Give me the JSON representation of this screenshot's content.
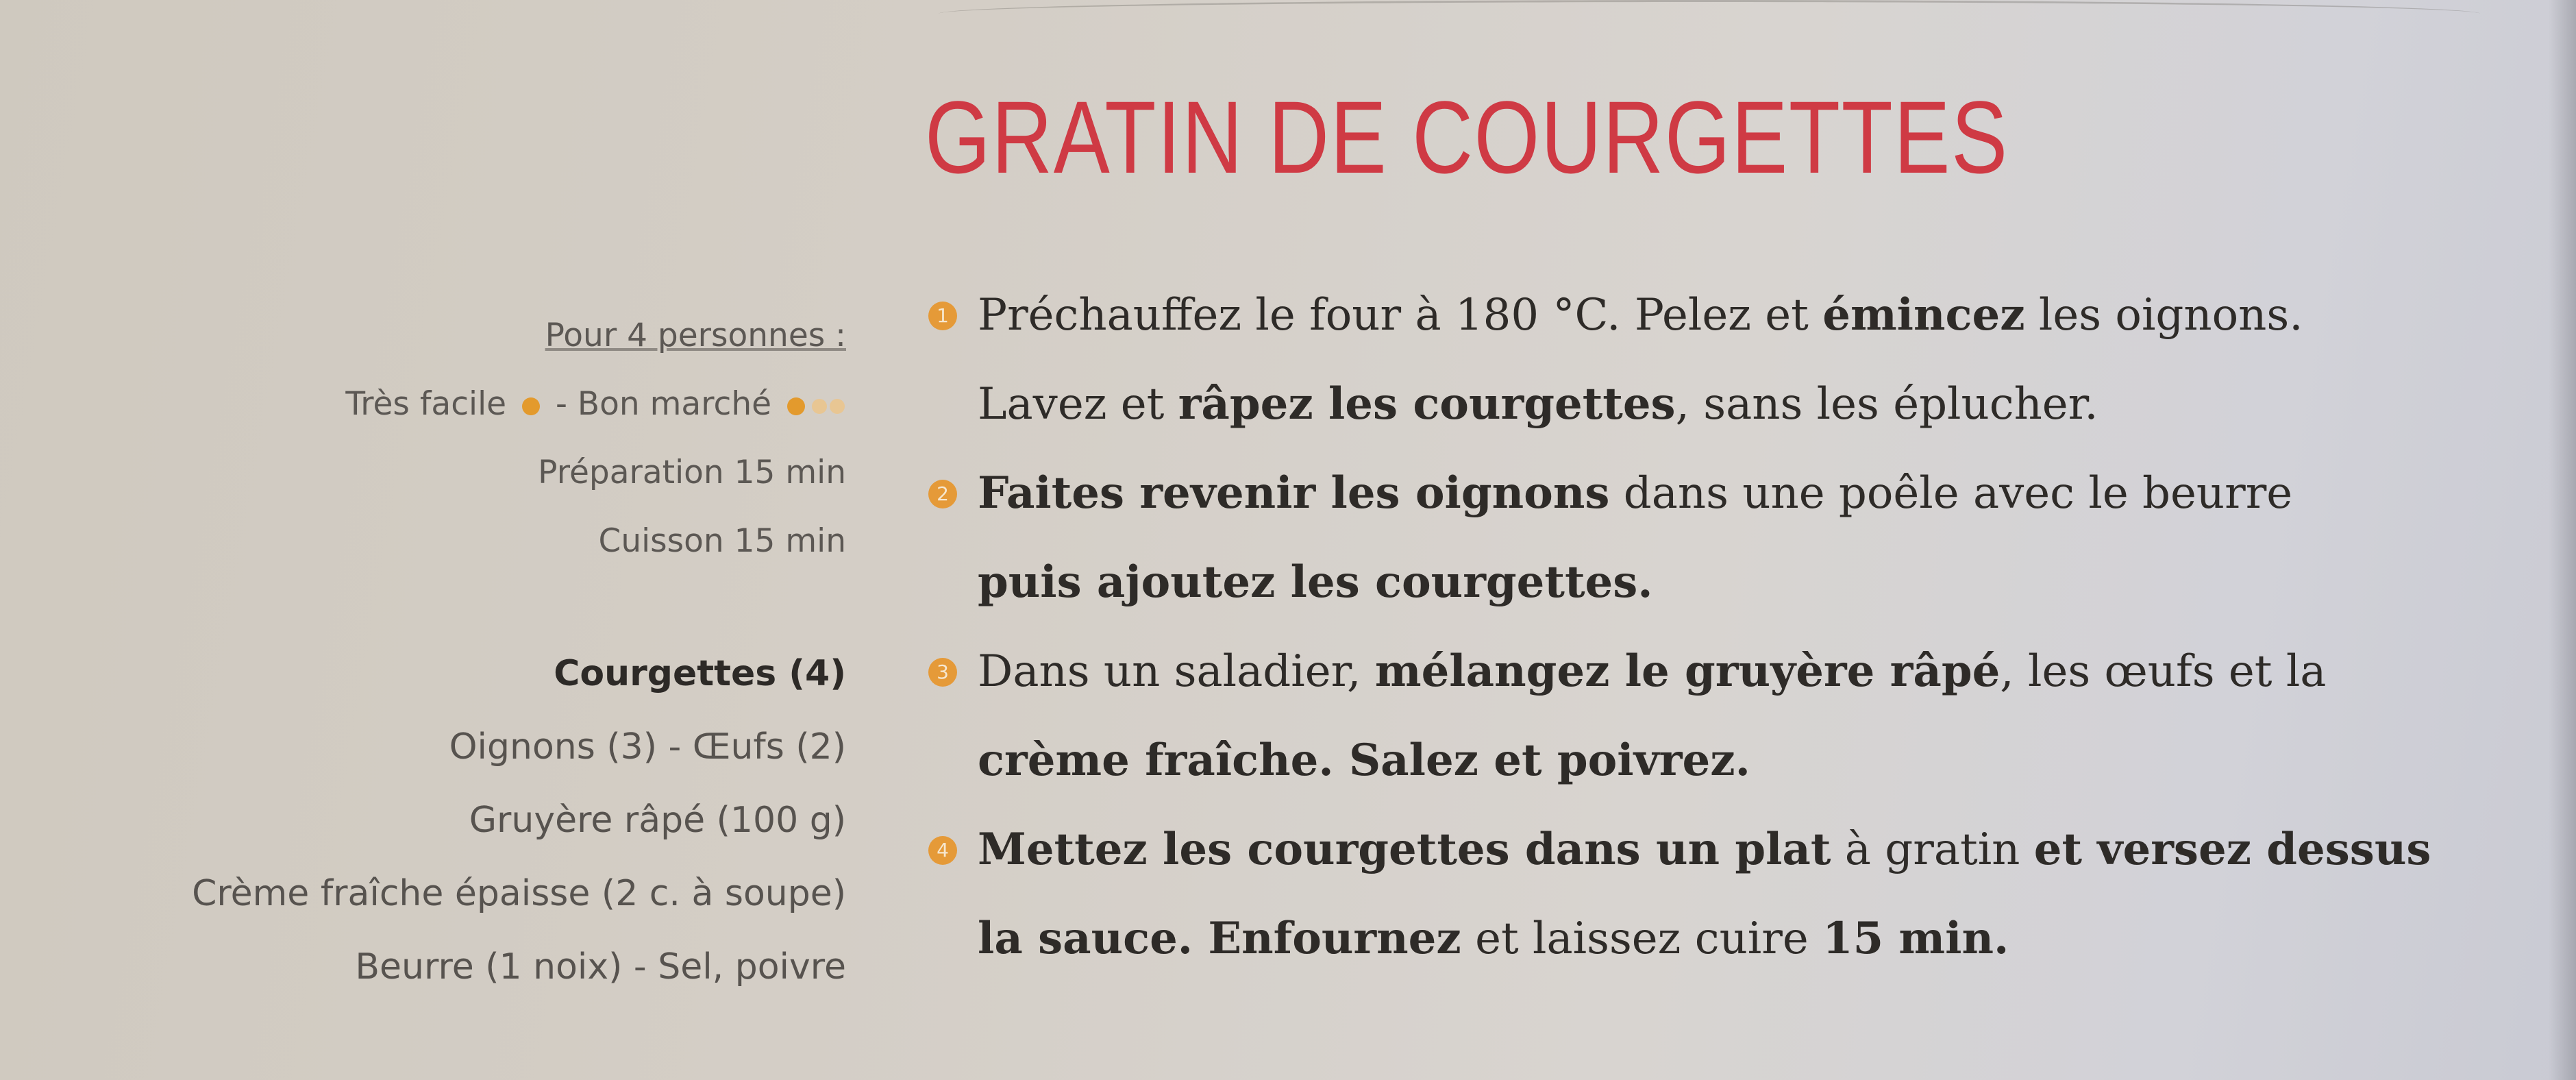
{
  "title": "GRATIN DE COURGETTES",
  "info": {
    "portions": "Pour 4 personnes :",
    "difficulty": "Très facile",
    "separator": "-",
    "price": "Bon marché",
    "preparation": "Préparation 15 min",
    "cooking": "Cuisson 15 min"
  },
  "ingredients": {
    "main": "Courgettes (4)",
    "lines": [
      "Oignons (3) - Œufs (2)",
      "Gruyère râpé (100 g)",
      "Crème fraîche épaisse (2 c. à soupe)",
      "Beurre (1 noix) - Sel, poivre"
    ]
  },
  "steps": [
    {
      "number": "1",
      "lines": [
        [
          {
            "text": "Préchauffez le four à 180 °C. Pelez et ",
            "bold": false
          },
          {
            "text": "émincez",
            "bold": true
          },
          {
            "text": " les oignons.",
            "bold": false
          }
        ],
        [
          {
            "text": "Lavez et ",
            "bold": false
          },
          {
            "text": "râpez les courgettes",
            "bold": true
          },
          {
            "text": ", sans les éplucher.",
            "bold": false
          }
        ]
      ]
    },
    {
      "number": "2",
      "lines": [
        [
          {
            "text": "Faites revenir les oignons",
            "bold": true
          },
          {
            "text": " dans une poêle avec le beurre",
            "bold": false
          }
        ],
        [
          {
            "text": "puis ajoutez les courgettes.",
            "bold": true
          }
        ]
      ]
    },
    {
      "number": "3",
      "lines": [
        [
          {
            "text": "Dans un saladier, ",
            "bold": false
          },
          {
            "text": "mélangez le gruyère râpé",
            "bold": true
          },
          {
            "text": ", les œufs et la",
            "bold": false
          }
        ],
        [
          {
            "text": "crème fraîche. Salez et poivrez.",
            "bold": true
          }
        ]
      ]
    },
    {
      "number": "4",
      "lines": [
        [
          {
            "text": "Mettez les courgettes dans un plat",
            "bold": true
          },
          {
            "text": " à gratin ",
            "bold": false
          },
          {
            "text": "et versez dessus",
            "bold": true
          }
        ],
        [
          {
            "text": "la sauce. Enfournez",
            "bold": true
          },
          {
            "text": " et laissez cuire ",
            "bold": false
          },
          {
            "text": "15 min.",
            "bold": true
          }
        ]
      ]
    }
  ]
}
